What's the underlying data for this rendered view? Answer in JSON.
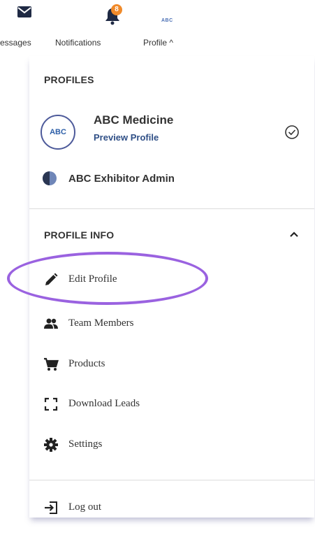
{
  "nav": {
    "messages_label": "Messages",
    "notifications_label": "Notifications",
    "notifications_count": "8",
    "profile_label": "Profile ^",
    "profile_logo_text": "ABC"
  },
  "profiles": {
    "section_title": "PROFILES",
    "items": [
      {
        "name": "ABC Medicine",
        "subtitle": "Preview Profile",
        "logo_text": "ABC",
        "selected": true
      },
      {
        "name": "ABC Exhibitor Admin"
      }
    ]
  },
  "profile_info": {
    "section_title": "PROFILE INFO",
    "items": [
      {
        "label": "Edit Profile",
        "icon": "pencil-icon"
      },
      {
        "label": "Team Members",
        "icon": "people-icon"
      },
      {
        "label": "Products",
        "icon": "cart-icon"
      },
      {
        "label": "Download Leads",
        "icon": "scan-frame-icon"
      },
      {
        "label": "Settings",
        "icon": "gear-icon"
      }
    ]
  },
  "logout": {
    "label": "Log out",
    "icon": "logout-icon"
  },
  "colors": {
    "accent_ring": "#9a62e0",
    "badge": "#f08a2a",
    "brand_blue": "#2f4f86"
  }
}
